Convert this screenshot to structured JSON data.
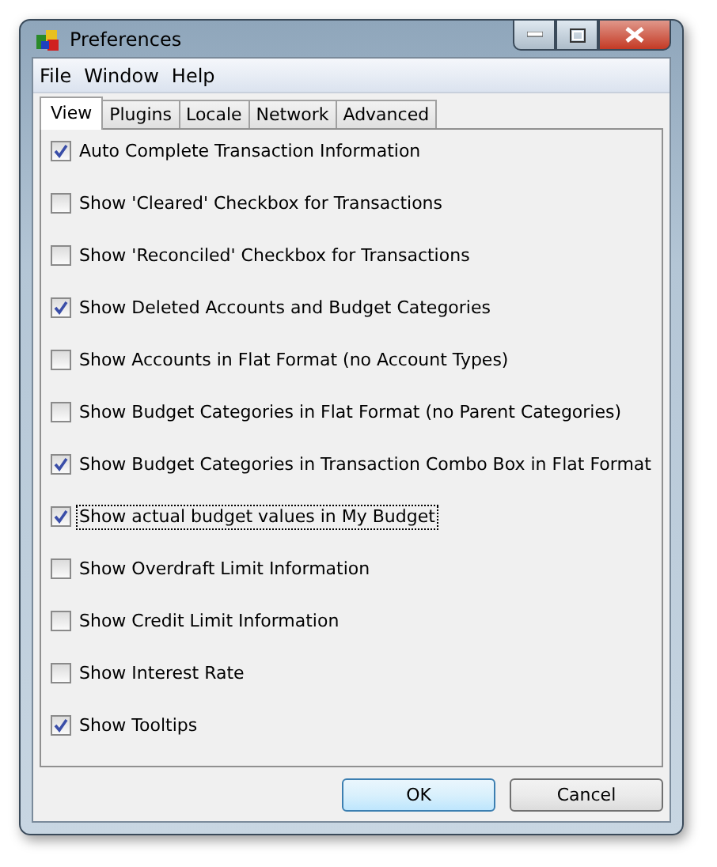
{
  "window": {
    "title": "Preferences"
  },
  "menu": [
    "File",
    "Window",
    "Help"
  ],
  "tabs": [
    {
      "label": "View",
      "selected": true
    },
    {
      "label": "Plugins",
      "selected": false
    },
    {
      "label": "Locale",
      "selected": false
    },
    {
      "label": "Network",
      "selected": false
    },
    {
      "label": "Advanced",
      "selected": false
    }
  ],
  "options": [
    {
      "label": "Auto Complete Transaction Information",
      "checked": true,
      "focused": false
    },
    {
      "label": "Show 'Cleared' Checkbox for Transactions",
      "checked": false,
      "focused": false
    },
    {
      "label": "Show 'Reconciled' Checkbox for Transactions",
      "checked": false,
      "focused": false
    },
    {
      "label": "Show Deleted Accounts and Budget Categories",
      "checked": true,
      "focused": false
    },
    {
      "label": "Show Accounts in Flat Format (no Account Types)",
      "checked": false,
      "focused": false
    },
    {
      "label": "Show Budget Categories in Flat Format (no Parent Categories)",
      "checked": false,
      "focused": false
    },
    {
      "label": "Show Budget Categories in Transaction Combo Box in Flat Format",
      "checked": true,
      "focused": false
    },
    {
      "label": "Show actual budget values in My Budget",
      "checked": true,
      "focused": true
    },
    {
      "label": "Show Overdraft Limit Information",
      "checked": false,
      "focused": false
    },
    {
      "label": "Show Credit Limit Information",
      "checked": false,
      "focused": false
    },
    {
      "label": "Show Interest Rate",
      "checked": false,
      "focused": false
    },
    {
      "label": "Show Tooltips",
      "checked": true,
      "focused": false
    }
  ],
  "buttons": [
    {
      "label": "OK",
      "default": true
    },
    {
      "label": "Cancel",
      "default": false
    }
  ]
}
